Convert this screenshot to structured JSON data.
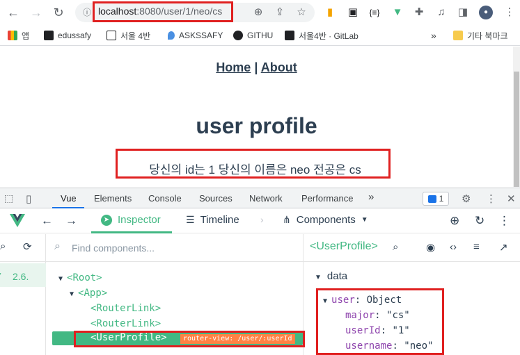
{
  "browser": {
    "url_host": "localhost",
    "url_path": ":8080/user/1/neo/cs",
    "bookmarks": [
      {
        "label": "앱",
        "icon": "apps-grid-icon"
      },
      {
        "label": "edussafy",
        "icon": "bookmark-icon"
      },
      {
        "label": "서울 4반",
        "icon": "notion-icon"
      },
      {
        "label": "ASKSSAFY",
        "icon": "location-pin-icon"
      },
      {
        "label": "GITHU",
        "icon": "github-icon"
      },
      {
        "label": "서울4반 · GitLab",
        "icon": "bookmark-icon"
      },
      {
        "label": "기타 북마크",
        "icon": "folder-icon"
      }
    ],
    "more_bookmarks": "»"
  },
  "page": {
    "nav_home": "Home",
    "nav_sep": " | ",
    "nav_about": "About",
    "heading": "user profile",
    "profile_text": "당신의 id는 1 당신의 이름은 neo 전공은 cs"
  },
  "devtools": {
    "tabs": [
      "Vue",
      "Elements",
      "Console",
      "Sources",
      "Network",
      "Performance"
    ],
    "more": "»",
    "issues_count": "1"
  },
  "vue": {
    "tab_inspector": "Inspector",
    "tab_timeline": "Timeline",
    "tab_components": "Components",
    "version": "2.6.",
    "search_placeholder": "Find components...",
    "tree": {
      "root": "<Root>",
      "app": "<App>",
      "link1": "<RouterLink>",
      "link2": "<RouterLink>",
      "selected": "<UserProfile>",
      "route_tag": "router-view: /user/:userId"
    },
    "inspector": {
      "component_title": "<UserProfile>",
      "data_label": "data",
      "user_key": "user",
      "user_type": ": Object",
      "fields": [
        {
          "key": "major",
          "value": "\"cs\""
        },
        {
          "key": "userId",
          "value": "\"1\""
        },
        {
          "key": "username",
          "value": "\"neo\""
        }
      ]
    }
  },
  "colors": {
    "vue_green": "#42b883",
    "highlight_red": "#e02020",
    "text_dark": "#2c3e50"
  }
}
